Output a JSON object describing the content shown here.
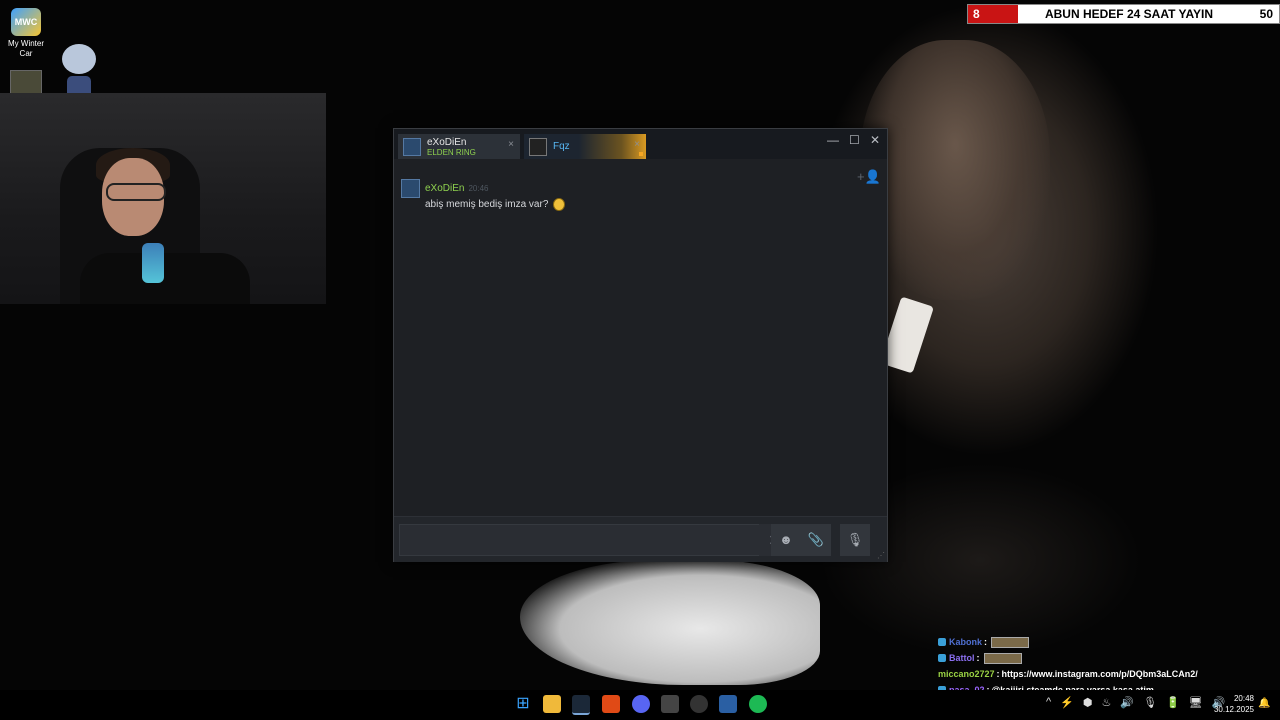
{
  "desktop": {
    "icon_label": "My Winter Car",
    "icon_logo_text": "MWC"
  },
  "goal_bar": {
    "current": "8",
    "title": "ABUN HEDEF 24 SAAT YAYIN",
    "target": "50",
    "progress": 0.16,
    "fill_color": "#c91414"
  },
  "steam_chat": {
    "tabs": [
      {
        "name": "eXoDiEn",
        "game": "ELDEN RING",
        "close": "×"
      },
      {
        "name": "Fqz",
        "close": "×"
      }
    ],
    "window_controls": {
      "minimize": "—",
      "maximize": "☐",
      "close": "✕"
    },
    "add_user_icon": "+👤",
    "messages": [
      {
        "author": "eXoDiEn",
        "time": "20:46",
        "text": "abiş memiş bediş imza var?"
      }
    ],
    "composer": {
      "input_value": "",
      "send_icon": "➤",
      "emoji_icon": "☻",
      "attach_icon": "📎",
      "voice_icon": "🎙"
    },
    "colors": {
      "ingame": "#8fd14f",
      "online": "#57b6f2",
      "window_bg": "#1e2024"
    }
  },
  "stream_chat": [
    {
      "user": "Kabonk",
      "text": ""
    },
    {
      "user": "Battol",
      "text": ""
    },
    {
      "user": "miccano2727",
      "text": "https://www.instagram.com/p/DQbm3aLCAn2/"
    },
    {
      "user": "pasa_02",
      "text": "@kaijiri steamde para varsa kasa atim"
    }
  ],
  "taskbar": {
    "start_icon": "⊞",
    "icons": [
      "file-explorer",
      "steam",
      "brave",
      "discord",
      "app",
      "app",
      "app",
      "spotify"
    ],
    "tray": [
      "^",
      "⚡",
      "⬢",
      "♨",
      "🔊",
      "🎙",
      "🔋",
      "🖥",
      "🔊"
    ],
    "time": "20:48",
    "date": "30.12.2025"
  }
}
